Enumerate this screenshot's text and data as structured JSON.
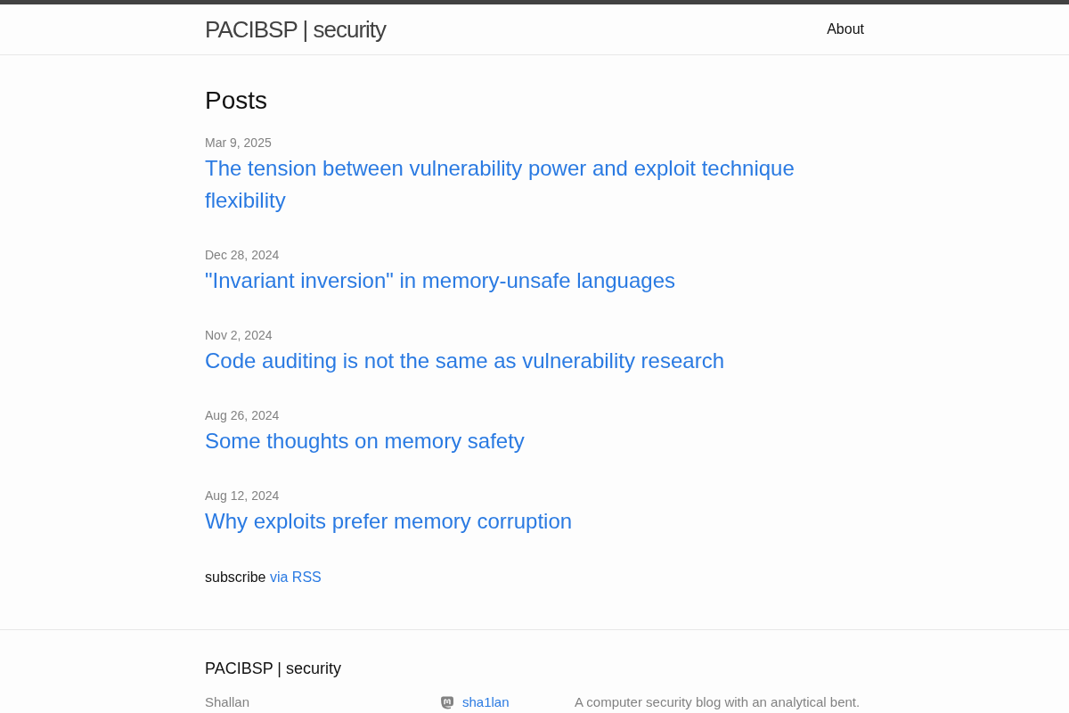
{
  "header": {
    "site_title": "PACIBSP | security",
    "nav": [
      {
        "label": "About"
      }
    ]
  },
  "main": {
    "heading": "Posts",
    "posts": [
      {
        "date": "Mar 9, 2025",
        "title": "The tension between vulnerability power and exploit technique flexibility"
      },
      {
        "date": "Dec 28, 2024",
        "title": "\"Invariant inversion\" in memory-unsafe languages"
      },
      {
        "date": "Nov 2, 2024",
        "title": "Code auditing is not the same as vulnerability research"
      },
      {
        "date": "Aug 26, 2024",
        "title": "Some thoughts on memory safety"
      },
      {
        "date": "Aug 12, 2024",
        "title": "Why exploits prefer memory corruption"
      }
    ],
    "subscribe": {
      "text": "subscribe",
      "link": "via RSS"
    }
  },
  "footer": {
    "title": "PACIBSP | security",
    "author": "Shallan",
    "social": [
      {
        "handle": "sha1lan"
      }
    ],
    "description": "A computer security blog with an analytical bent."
  }
}
